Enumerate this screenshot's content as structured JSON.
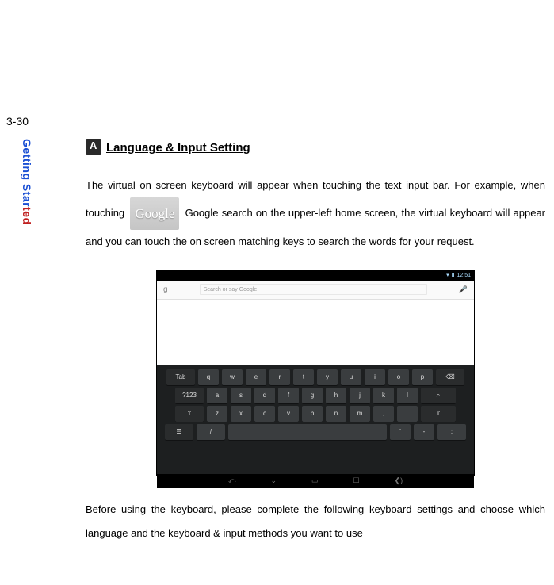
{
  "page_number": "3-30",
  "sidebar_label_part1": "Getting Star",
  "sidebar_label_part2": "ted",
  "heading": "Language & Input Setting",
  "para1_a": "The virtual on screen keyboard will appear when touching the text input bar. For example, when touching ",
  "google_logo_text": "Google",
  "para1_b": " Google search on the upper-left home screen, the virtual keyboard will appear and you can touch the on screen matching keys to search the words for your request.",
  "para2": "Before using the keyboard, please complete the following keyboard settings and choose which language and the keyboard & input methods you want to use",
  "screenshot": {
    "status_time": "12:51",
    "search_placeholder": "Search or say Google",
    "keyboard": {
      "row1_label": "Tab",
      "row1_keys": [
        "q",
        "w",
        "e",
        "r",
        "t",
        "y",
        "u",
        "i",
        "o",
        "p"
      ],
      "row1_backspace": "⌫",
      "row2_label": "?123",
      "row2_keys": [
        "a",
        "s",
        "d",
        "f",
        "g",
        "h",
        "j",
        "k",
        "l"
      ],
      "row2_search": "⌕",
      "row3_shift_l": "⇧",
      "row3_keys": [
        "z",
        "x",
        "c",
        "v",
        "b",
        "n",
        "m",
        ",",
        "."
      ],
      "row3_shift_r": "⇧",
      "row4_globe": "☰",
      "row4_slash": "/",
      "row4_quote": "'",
      "row4_dash": "-",
      "row4_colon": ":"
    },
    "nav_icons": [
      "⤺",
      "⌄",
      "▭",
      "☐",
      "❮)"
    ]
  }
}
